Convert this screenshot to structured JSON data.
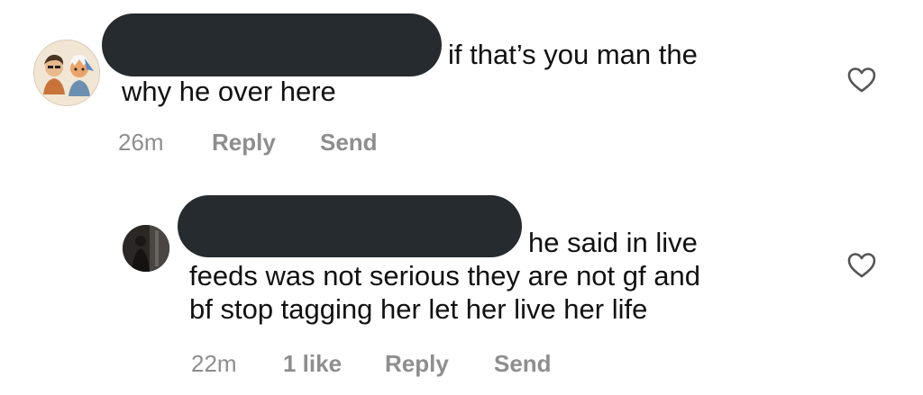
{
  "comments": [
    {
      "avatar_icon": "cartoon-couple-avatar",
      "text_line1": "if that’s you man the",
      "text_line2": "why he over here",
      "time": "26m",
      "reply_label": "Reply",
      "send_label": "Send",
      "heart_icon": "heart-outline-icon"
    },
    {
      "avatar_icon": "dark-photo-avatar",
      "text_line1": "he said in live",
      "text_line2": "feeds was not serious they are not gf and",
      "text_line3": "bf stop tagging her let her live her life",
      "time": "22m",
      "likes": "1 like",
      "reply_label": "Reply",
      "send_label": "Send",
      "heart_icon": "heart-outline-icon"
    }
  ],
  "colors": {
    "redaction": "#262b2f",
    "text": "#111111",
    "meta": "#8e8e8e"
  }
}
